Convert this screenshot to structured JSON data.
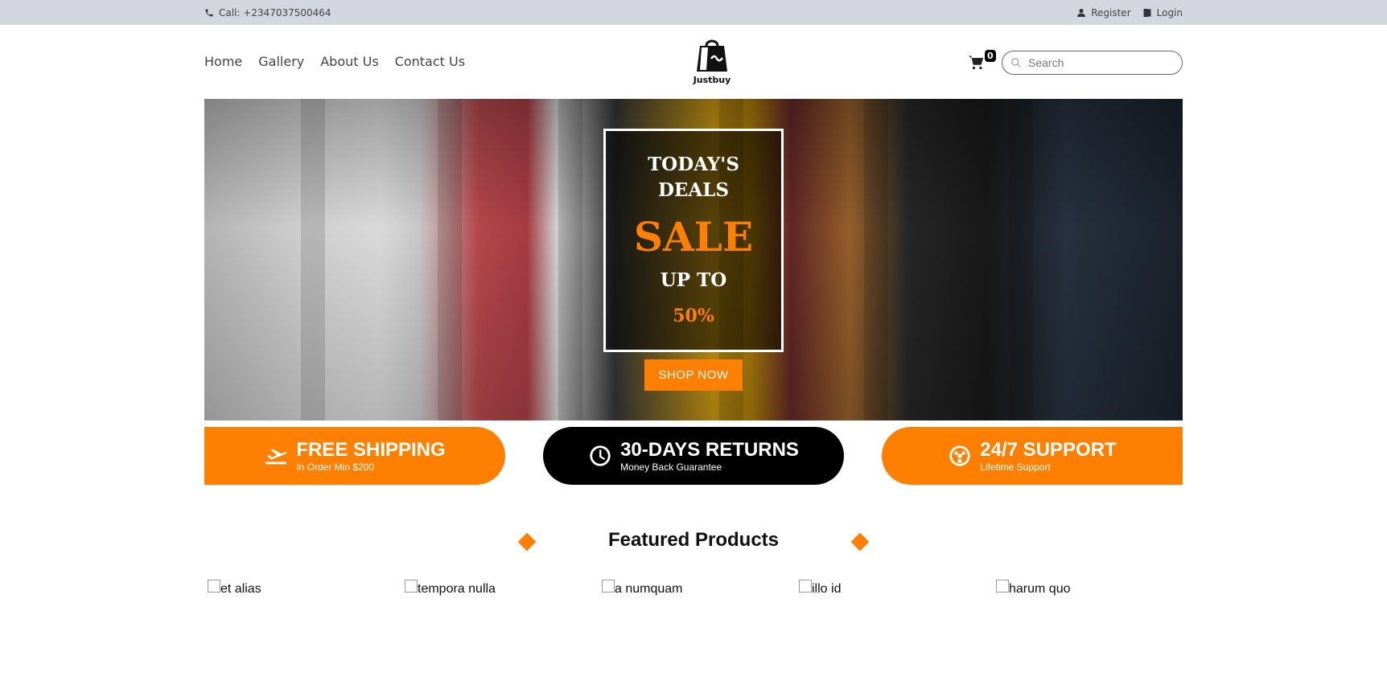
{
  "topbar": {
    "phone": "Call: +2347037500464",
    "register": "Register",
    "login": "Login"
  },
  "nav": [
    "Home",
    "Gallery",
    "About Us",
    "Contact Us"
  ],
  "logo": {
    "text": "Justbuy"
  },
  "cart": {
    "count": "0"
  },
  "search": {
    "placeholder": "Search"
  },
  "hero": {
    "line1": "TODAY'S",
    "line2": "DEALS",
    "sale": "SALE",
    "upto": "UP TO",
    "percent": "50%",
    "button": "SHOP NOW"
  },
  "features": [
    {
      "title": "FREE SHIPPING",
      "subtitle": "In Order Min $200",
      "icon": "plane-icon"
    },
    {
      "title": "30-DAYS RETURNS",
      "subtitle": "Money Back Guarantee",
      "icon": "clock-icon"
    },
    {
      "title": "24/7 SUPPORT",
      "subtitle": "Lifetime Support",
      "icon": "support-icon"
    }
  ],
  "featured": {
    "title": "Featured Products"
  },
  "products": [
    "et alias",
    "tempora nulla",
    "a numquam",
    "illo id",
    "harum quo"
  ],
  "colors": {
    "accent": "#ff7f00",
    "topbar": "#d3d6de",
    "dark": "#000000"
  }
}
